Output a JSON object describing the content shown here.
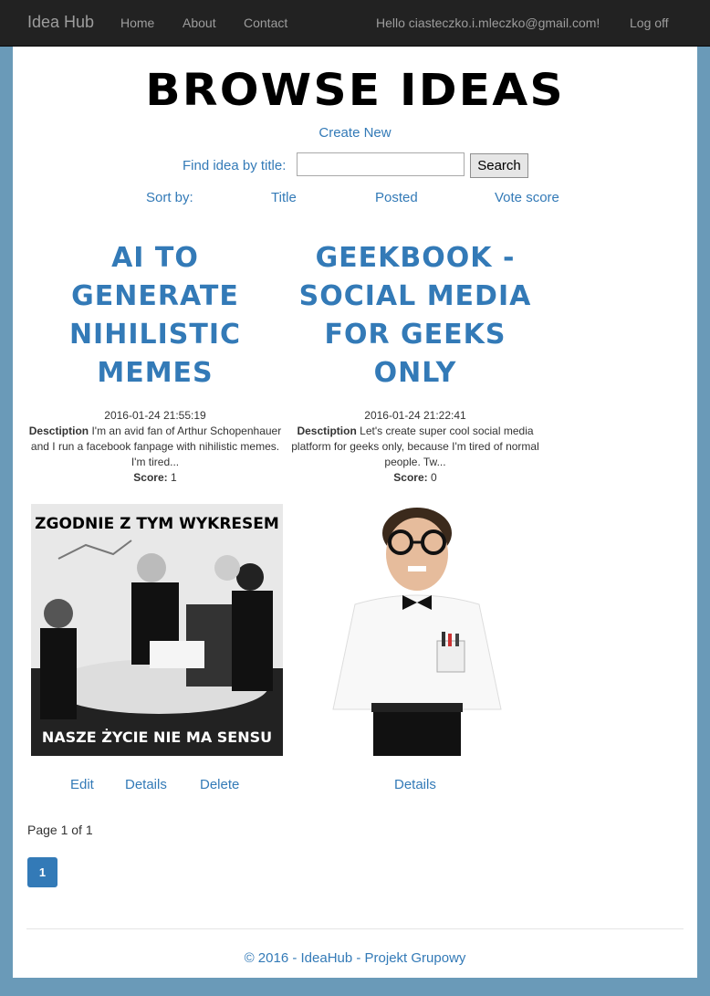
{
  "navbar": {
    "brand": "Idea Hub",
    "links": [
      "Home",
      "About",
      "Contact"
    ],
    "greeting": "Hello ciasteczko.i.mleczko@gmail.com!",
    "logoff": "Log off"
  },
  "page": {
    "title": "BROWSE IDEAS",
    "create_new": "Create New",
    "search_label": "Find idea by title:",
    "search_value": "",
    "search_button": "Search",
    "sort_label": "Sort by:",
    "sort_options": [
      "Title",
      "Posted",
      "Vote score"
    ]
  },
  "ideas": [
    {
      "title": "AI to generate nihilistic memes",
      "date": "2016-01-24 21:55:19",
      "desc_label": "Desctiption",
      "desc": "I'm an avid fan of Arthur Schopenhauer and I run a facebook fanpage with nihilistic memes. I'm tired...",
      "score_label": "Score:",
      "score": "1",
      "image_top_text": "ZGODNIE Z TYM WYKRESEM",
      "image_bottom_text": "NASZE ŻYCIE NIE MA SENSU",
      "actions": [
        "Edit",
        "Details",
        "Delete"
      ]
    },
    {
      "title": "Geekbook - Social media for geeks only",
      "date": "2016-01-24 21:22:41",
      "desc_label": "Desctiption",
      "desc": "Let's create super cool social media platform for geeks only, because I'm tired of normal people. Tw...",
      "score_label": "Score:",
      "score": "0",
      "actions": [
        "Details"
      ]
    }
  ],
  "pagination": {
    "text": "Page 1 of 1",
    "current": "1"
  },
  "footer": "© 2016 - IdeaHub - Projekt Grupowy",
  "colors": {
    "navbar": "#222222",
    "link": "#337ab7",
    "background": "#6a9ab8"
  }
}
